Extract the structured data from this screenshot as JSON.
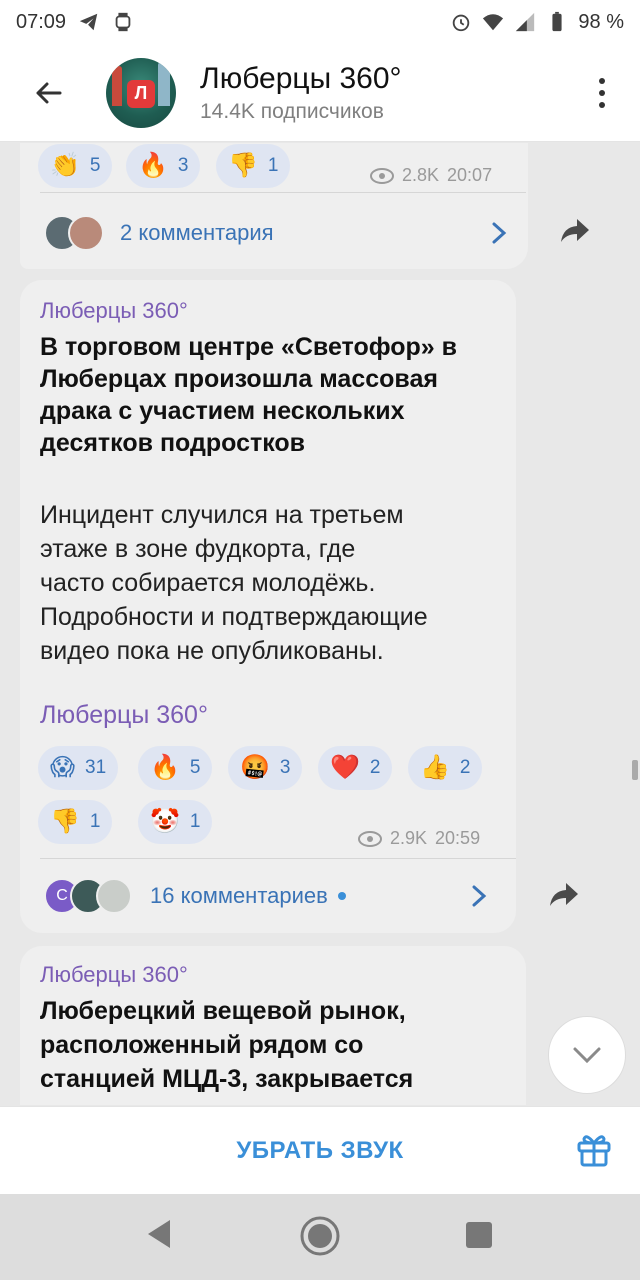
{
  "status": {
    "time": "07:09",
    "battery": "98 %"
  },
  "header": {
    "title": "Люберцы 360°",
    "subtitle": "14.4K подписчиков",
    "avatar_letter": "Л"
  },
  "post1": {
    "reactions": [
      {
        "icon": "clapping-hands",
        "emoji": "👏",
        "count": "5"
      },
      {
        "icon": "fire",
        "emoji": "🔥",
        "count": "3"
      },
      {
        "icon": "thumbs-down",
        "emoji": "👎",
        "count": "1"
      }
    ],
    "views": "2.8K",
    "time": "20:07",
    "comments": "2 комментария"
  },
  "post2": {
    "from": "Люберцы 360°",
    "title": "В торговом центре «Светофор» в Люберцах произошла массовая драка с участием нескольких десятков подростков",
    "title_lines": [
      "В торговом центре «Светофор» в",
      "Люберцах произошла массовая",
      "драка с участием нескольких",
      "десятков подростков"
    ],
    "text_lines": [
      "Инцидент случился на третьем",
      "этаже в зоне фудкорта, где",
      "часто собирается молодёжь.",
      "Подробности и подтверждающие",
      "видео пока не опубликованы."
    ],
    "signature": "Люберцы 360°",
    "reactions": [
      {
        "icon": "screaming-face",
        "emoji": "😱",
        "count": "31"
      },
      {
        "icon": "fire",
        "emoji": "🔥",
        "count": "5"
      },
      {
        "icon": "cursing-face",
        "emoji": "🤬",
        "count": "3"
      },
      {
        "icon": "red-heart",
        "emoji": "❤️",
        "count": "2"
      },
      {
        "icon": "thumbs-up",
        "emoji": "👍",
        "count": "2"
      },
      {
        "icon": "thumbs-down",
        "emoji": "👎",
        "count": "1"
      },
      {
        "icon": "clown-face",
        "emoji": "🤡",
        "count": "1"
      }
    ],
    "views": "2.9K",
    "time": "20:59",
    "comment_avatar_letter": "С",
    "comments": "16 комментариев"
  },
  "post3": {
    "from": "Люберцы 360°",
    "title_lines": [
      "Люберецкий вещевой рынок,",
      "расположенный рядом со",
      "станцией МЦД-3, закрывается"
    ]
  },
  "bottom": {
    "mute_label": "УБРАТЬ ЗВУК"
  }
}
